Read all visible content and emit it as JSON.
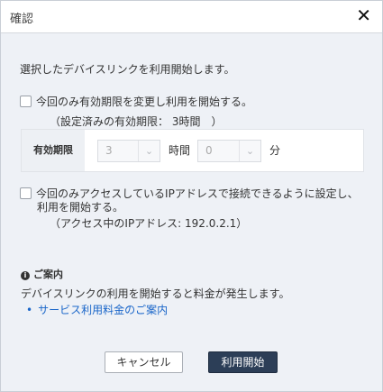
{
  "dialog": {
    "title": "確認",
    "close_glyph": "✕"
  },
  "intro": "選択したデバイスリンクを利用開始します。",
  "option_change_period": {
    "label": "今回のみ有効期限を変更し利用を開始する。",
    "current_setting": "（設定済みの有効期限： 3時間　）",
    "checked": false
  },
  "period": {
    "label": "有効期限",
    "hours_value": "3",
    "hours_unit": "時間",
    "minutes_value": "0",
    "minutes_unit": "分",
    "chevron_icon": "chevron-down-icon"
  },
  "option_ip": {
    "label_line1": "今回のみアクセスしているIPアドレスで接続できるように設定し、",
    "label_line2": "利用を開始する。",
    "current_ip": "（アクセス中のIPアドレス: 192.0.2.1）",
    "checked": false
  },
  "info": {
    "heading": "ご案内",
    "icon": "info-icon",
    "text": "デバイスリンクの利用を開始すると料金が発生します。",
    "link": "サービス利用料金のご案内"
  },
  "buttons": {
    "cancel": "キャンセル",
    "start": "利用開始"
  },
  "colors": {
    "link": "#1a66c9",
    "primary_button": "#2c3e57",
    "background": "#eef1f6"
  }
}
